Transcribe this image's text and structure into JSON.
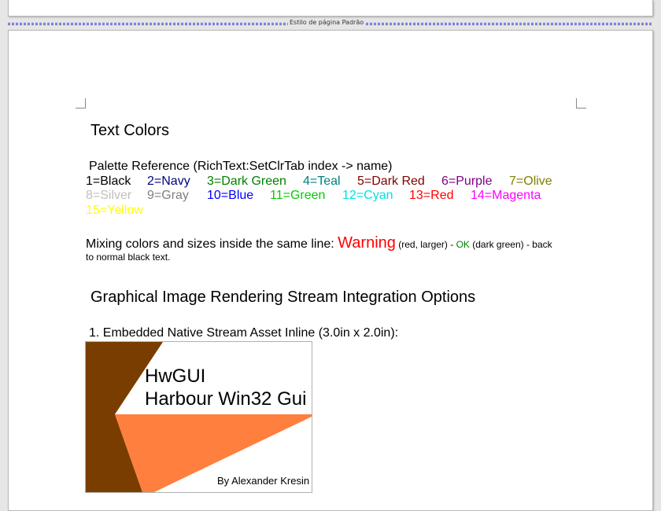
{
  "page_style_label": "Estilo de página Padrão",
  "heading_text_colors": "Text Colors",
  "palette_reference": "Palette Reference (RichText:SetClrTab index -> name)",
  "palette": [
    {
      "label": "1=Black",
      "color": "#000000"
    },
    {
      "label": "2=Navy",
      "color": "#000080"
    },
    {
      "label": "3=Dark Green",
      "color": "#008000"
    },
    {
      "label": "4=Teal",
      "color": "#008080"
    },
    {
      "label": "5=Dark Red",
      "color": "#800000"
    },
    {
      "label": "6=Purple",
      "color": "#800080"
    },
    {
      "label": "7=Olive",
      "color": "#808000"
    },
    {
      "label": "8=Silver",
      "color": "#c0c0c0"
    },
    {
      "label": "9=Gray",
      "color": "#808080"
    },
    {
      "label": "10=Blue",
      "color": "#0000ff"
    },
    {
      "label": "11=Green",
      "color": "#00cc00"
    },
    {
      "label": "12=Cyan",
      "color": "#00e0e0"
    },
    {
      "label": "13=Red",
      "color": "#ff0000"
    },
    {
      "label": "14=Magenta",
      "color": "#ff00ff"
    },
    {
      "label": "15=Yellow",
      "color": "#ffff00"
    }
  ],
  "mixing": {
    "prefix": "Mixing colors and sizes inside the same line: ",
    "warning": "Warning",
    "warning_note": " (red, larger) - ",
    "ok": "OK",
    "ok_note": " (dark green) - back",
    "line2": "to normal black text."
  },
  "heading_images": "Graphical Image Rendering Stream Integration Options",
  "image_caption": "1. Embedded Native Stream Asset Inline (3.0in x 2.0in):",
  "image": {
    "line1": "HwGUI",
    "line2": "Harbour Win32 Gui",
    "byline": "By Alexander Kresin",
    "brown": "#7a3d00",
    "orange": "#ff7f3f"
  }
}
